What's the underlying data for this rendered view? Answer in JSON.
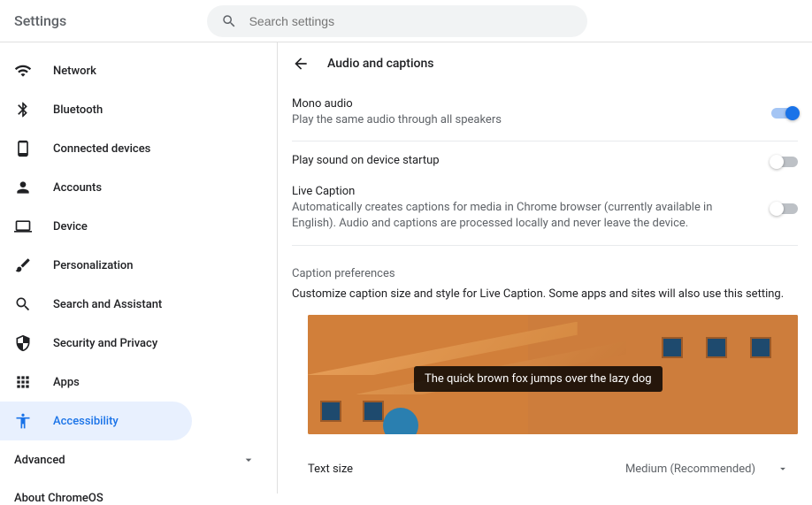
{
  "header": {
    "title": "Settings",
    "search_placeholder": "Search settings"
  },
  "sidebar": {
    "items": [
      {
        "label": "Network"
      },
      {
        "label": "Bluetooth"
      },
      {
        "label": "Connected devices"
      },
      {
        "label": "Accounts"
      },
      {
        "label": "Device"
      },
      {
        "label": "Personalization"
      },
      {
        "label": "Search and Assistant"
      },
      {
        "label": "Security and Privacy"
      },
      {
        "label": "Apps"
      },
      {
        "label": "Accessibility"
      }
    ],
    "advanced": "Advanced",
    "about": "About ChromeOS"
  },
  "page": {
    "title": "Audio and captions"
  },
  "settings": {
    "mono": {
      "title": "Mono audio",
      "desc": "Play the same audio through all speakers",
      "enabled": true
    },
    "startup_sound": {
      "title": "Play sound on device startup",
      "enabled": false
    },
    "live_caption": {
      "title": "Live Caption",
      "desc": "Automatically creates captions for media in Chrome browser (currently available in English). Audio and captions are processed locally and never leave the device.",
      "enabled": false
    }
  },
  "caption_prefs": {
    "heading": "Caption preferences",
    "desc": "Customize caption size and style for Live Caption. Some apps and sites will also use this setting.",
    "preview_text": "The quick brown fox jumps over the lazy dog",
    "text_size_label": "Text size",
    "text_size_value": "Medium (Recommended)"
  }
}
